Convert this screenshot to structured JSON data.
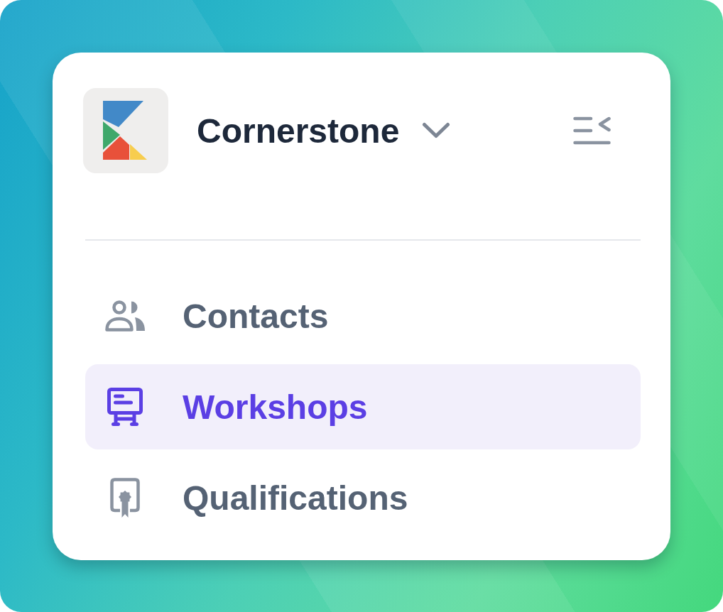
{
  "workspace": {
    "name": "Cornerstone"
  },
  "nav": {
    "items": [
      {
        "label": "Contacts",
        "selected": false
      },
      {
        "label": "Workshops",
        "selected": true
      },
      {
        "label": "Qualifications",
        "selected": false
      }
    ]
  }
}
